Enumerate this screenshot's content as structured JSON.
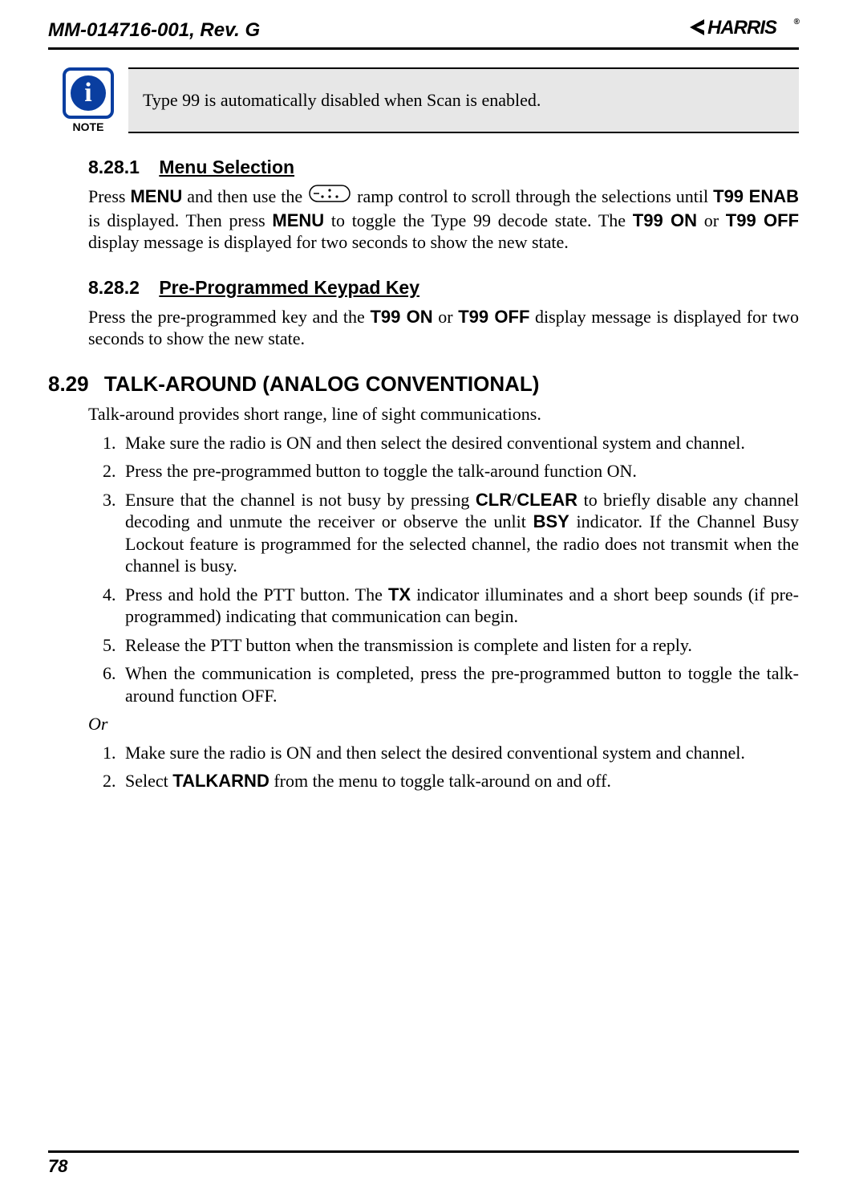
{
  "header": {
    "doc_id": "MM-014716-001, Rev. G",
    "logo_text": "HARRIS",
    "logo_reg": "®"
  },
  "note": {
    "icon_letter": "i",
    "label": "NOTE",
    "text": "Type 99 is automatically disabled when Scan is enabled."
  },
  "s1": {
    "num": "8.28.1",
    "title": "Menu Selection",
    "p_a": "Press ",
    "p_b": "MENU",
    "p_c": " and then use the ",
    "p_d": " ramp control to scroll through the selections until ",
    "p_e": "T99 ENAB",
    "p_f": " is displayed. Then press ",
    "p_g": "MENU",
    "p_h": " to toggle the Type 99 decode state. The ",
    "p_i": "T99 ON",
    "p_j": " or ",
    "p_k": "T99 OFF",
    "p_l": " display message is displayed for two seconds to show the new state."
  },
  "s2": {
    "num": "8.28.2",
    "title": "Pre-Programmed Keypad Key",
    "p_a": "Press the pre-programmed key and the ",
    "p_b": "T99 ON",
    "p_c": " or ",
    "p_d": "T99 OFF",
    "p_e": " display message is displayed for two seconds to show the new state."
  },
  "s3": {
    "num": "8.29",
    "title": "TALK-AROUND (ANALOG CONVENTIONAL)",
    "intro": "Talk-around provides short range, line of sight communications.",
    "steps_a": {
      "1": "Make sure the radio is ON and then select the desired conventional system and channel.",
      "2": "Press the pre-programmed button to toggle the talk-around function ON.",
      "3_a": "Ensure that the channel is not busy by pressing ",
      "3_b": "CLR",
      "3_c": "/",
      "3_d": "CLEAR",
      "3_e": " to briefly disable any channel decoding and unmute the receiver or observe the unlit ",
      "3_f": "BSY",
      "3_g": " indicator. If the Channel Busy Lockout feature is programmed for the selected channel, the radio does not transmit when the channel is busy.",
      "4_a": "Press and hold the PTT button. The ",
      "4_b": "TX",
      "4_c": " indicator illuminates and a short beep sounds (if pre-programmed) indicating that communication can begin.",
      "5": "Release the PTT button when the transmission is complete and listen for a reply.",
      "6": "When the communication is completed, press the pre-programmed button to toggle the talk-around function OFF."
    },
    "or": "Or",
    "steps_b": {
      "1": "Make sure the radio is ON and then select the desired conventional system and channel.",
      "2_a": "Select ",
      "2_b": "TALKARND",
      "2_c": " from the menu to toggle talk-around on and off."
    }
  },
  "footer": {
    "page": "78"
  }
}
